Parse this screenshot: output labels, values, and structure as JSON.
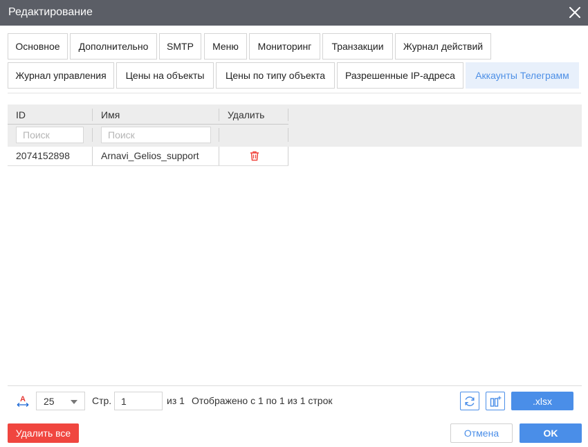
{
  "window": {
    "title": "Редактирование"
  },
  "tabs": [
    {
      "label": "Основное"
    },
    {
      "label": "Дополнительно"
    },
    {
      "label": "SMTP"
    },
    {
      "label": "Меню"
    },
    {
      "label": "Мониторинг"
    },
    {
      "label": "Транзакции"
    },
    {
      "label": "Журнал действий"
    },
    {
      "label": "Журнал управления"
    },
    {
      "label": "Цены на объекты"
    },
    {
      "label": "Цены по типу объекта"
    },
    {
      "label": "Разрешенные IP-адреса"
    },
    {
      "label": "Аккаунты Телеграмм",
      "active": true
    }
  ],
  "table": {
    "columns": [
      "ID",
      "Имя",
      "Удалить"
    ],
    "filter_placeholder": "Поиск",
    "rows": [
      {
        "id": "2074152898",
        "name": "Arnavi_Gelios_support"
      }
    ]
  },
  "pager": {
    "page_size": "25",
    "page_label": "Стр.",
    "page_value": "1",
    "of_label": "из 1",
    "summary": "Отображено с 1 по 1 из 1 строк",
    "export_label": ".xlsx"
  },
  "actions": {
    "delete_all": "Удалить все",
    "cancel": "Отмена",
    "ok": "OK"
  },
  "colors": {
    "titlebar": "#5b5e66",
    "accent": "#4a8ee8",
    "active_tab_bg": "#e8f0fb",
    "danger": "#f0463f"
  }
}
